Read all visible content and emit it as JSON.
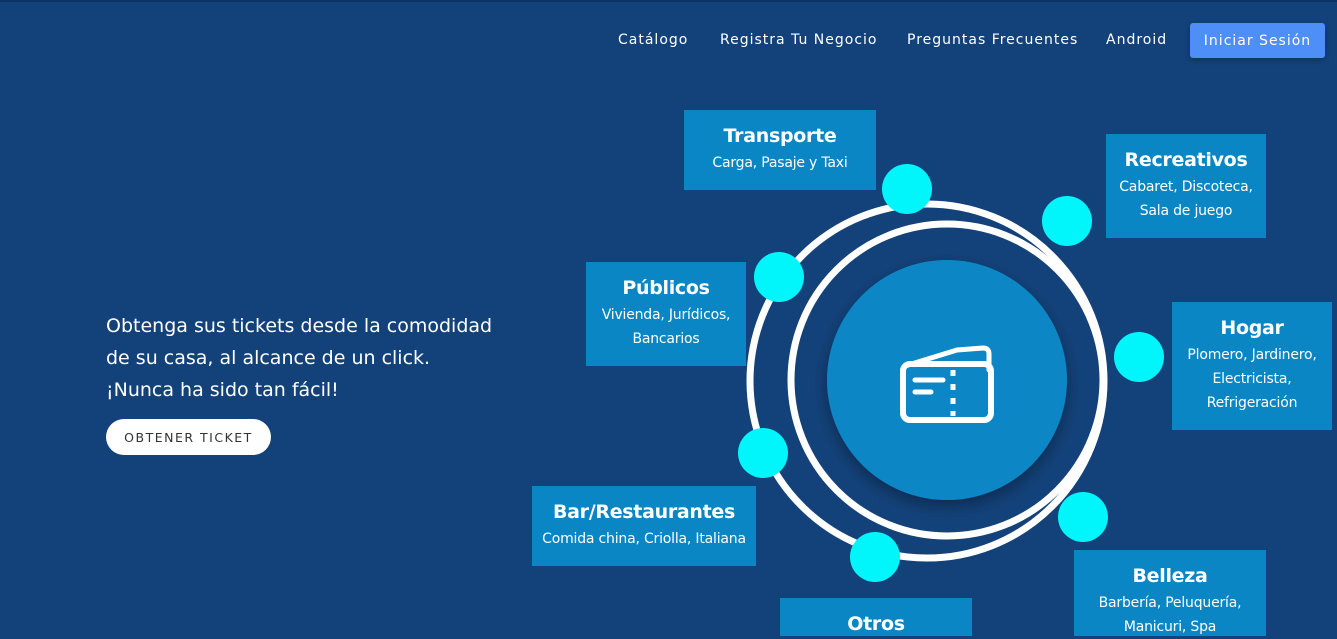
{
  "nav": {
    "items": [
      {
        "label": "Catálogo"
      },
      {
        "label": "Registra Tu Negocio"
      },
      {
        "label": "Preguntas Frecuentes"
      },
      {
        "label": "Android"
      }
    ],
    "login_label": "Iniciar Sesión"
  },
  "hero": {
    "line1": "Obtenga sus tickets desde la comodidad",
    "line2": "de su casa, al alcance de un click.",
    "line3": "¡Nunca ha sido tan fácil!",
    "cta_label": "OBTENER TICKET"
  },
  "categories": [
    {
      "title": "Transporte",
      "lines": [
        "Carga, Pasaje y Taxi"
      ]
    },
    {
      "title": "Recreativos",
      "lines": [
        "Cabaret, Discoteca,",
        "Sala de juego"
      ]
    },
    {
      "title": "Públicos",
      "lines": [
        "Vivienda, Jurídicos,",
        "Bancarios"
      ]
    },
    {
      "title": "Hogar",
      "lines": [
        "Plomero, Jardinero,",
        "Electricista,",
        "Refrigeración"
      ]
    },
    {
      "title": "Bar/Restaurantes",
      "lines": [
        "Comida china, Criolla, Italiana"
      ]
    },
    {
      "title": "Belleza",
      "lines": [
        "Barbería, Peluquería,",
        "Manicuri, Spa"
      ]
    },
    {
      "title": "Otros",
      "lines": []
    }
  ],
  "colors": {
    "background": "#13427a",
    "card": "#0a86c5",
    "dot": "#00f6fb",
    "center_circle": "#0a86c5",
    "login_button": "#4d8ef7"
  },
  "icons": {
    "center": "ticket-icon"
  }
}
